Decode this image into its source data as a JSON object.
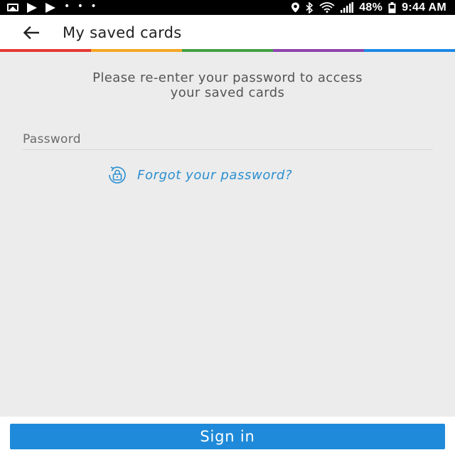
{
  "status_bar": {
    "notification_icons": [
      "image-icon",
      "play-store-icon",
      "play-store-icon"
    ],
    "more_dots": "• • •",
    "right_icons": [
      "location-icon",
      "bluetooth-icon",
      "wifi-icon",
      "signal-icon",
      "battery-icon"
    ],
    "battery": "48%",
    "time": "9:44 AM"
  },
  "toolbar": {
    "back_icon": "arrow-left-icon",
    "title": "My saved cards",
    "accent_colors": [
      "#e53935",
      "#f5a623",
      "#43a047",
      "#8e44ad",
      "#1e88e5"
    ]
  },
  "content": {
    "prompt_line1": "Please re-enter your password to access",
    "prompt_line2": "your saved cards",
    "password_placeholder": "Password",
    "password_value": "",
    "forgot_icon": "lock-reset-icon",
    "forgot_label": "Forgot your password?"
  },
  "footer": {
    "signin_label": "Sign in"
  },
  "colors": {
    "accent": "#1f8ad9",
    "link": "#2b8fd0",
    "background": "#ececec"
  }
}
